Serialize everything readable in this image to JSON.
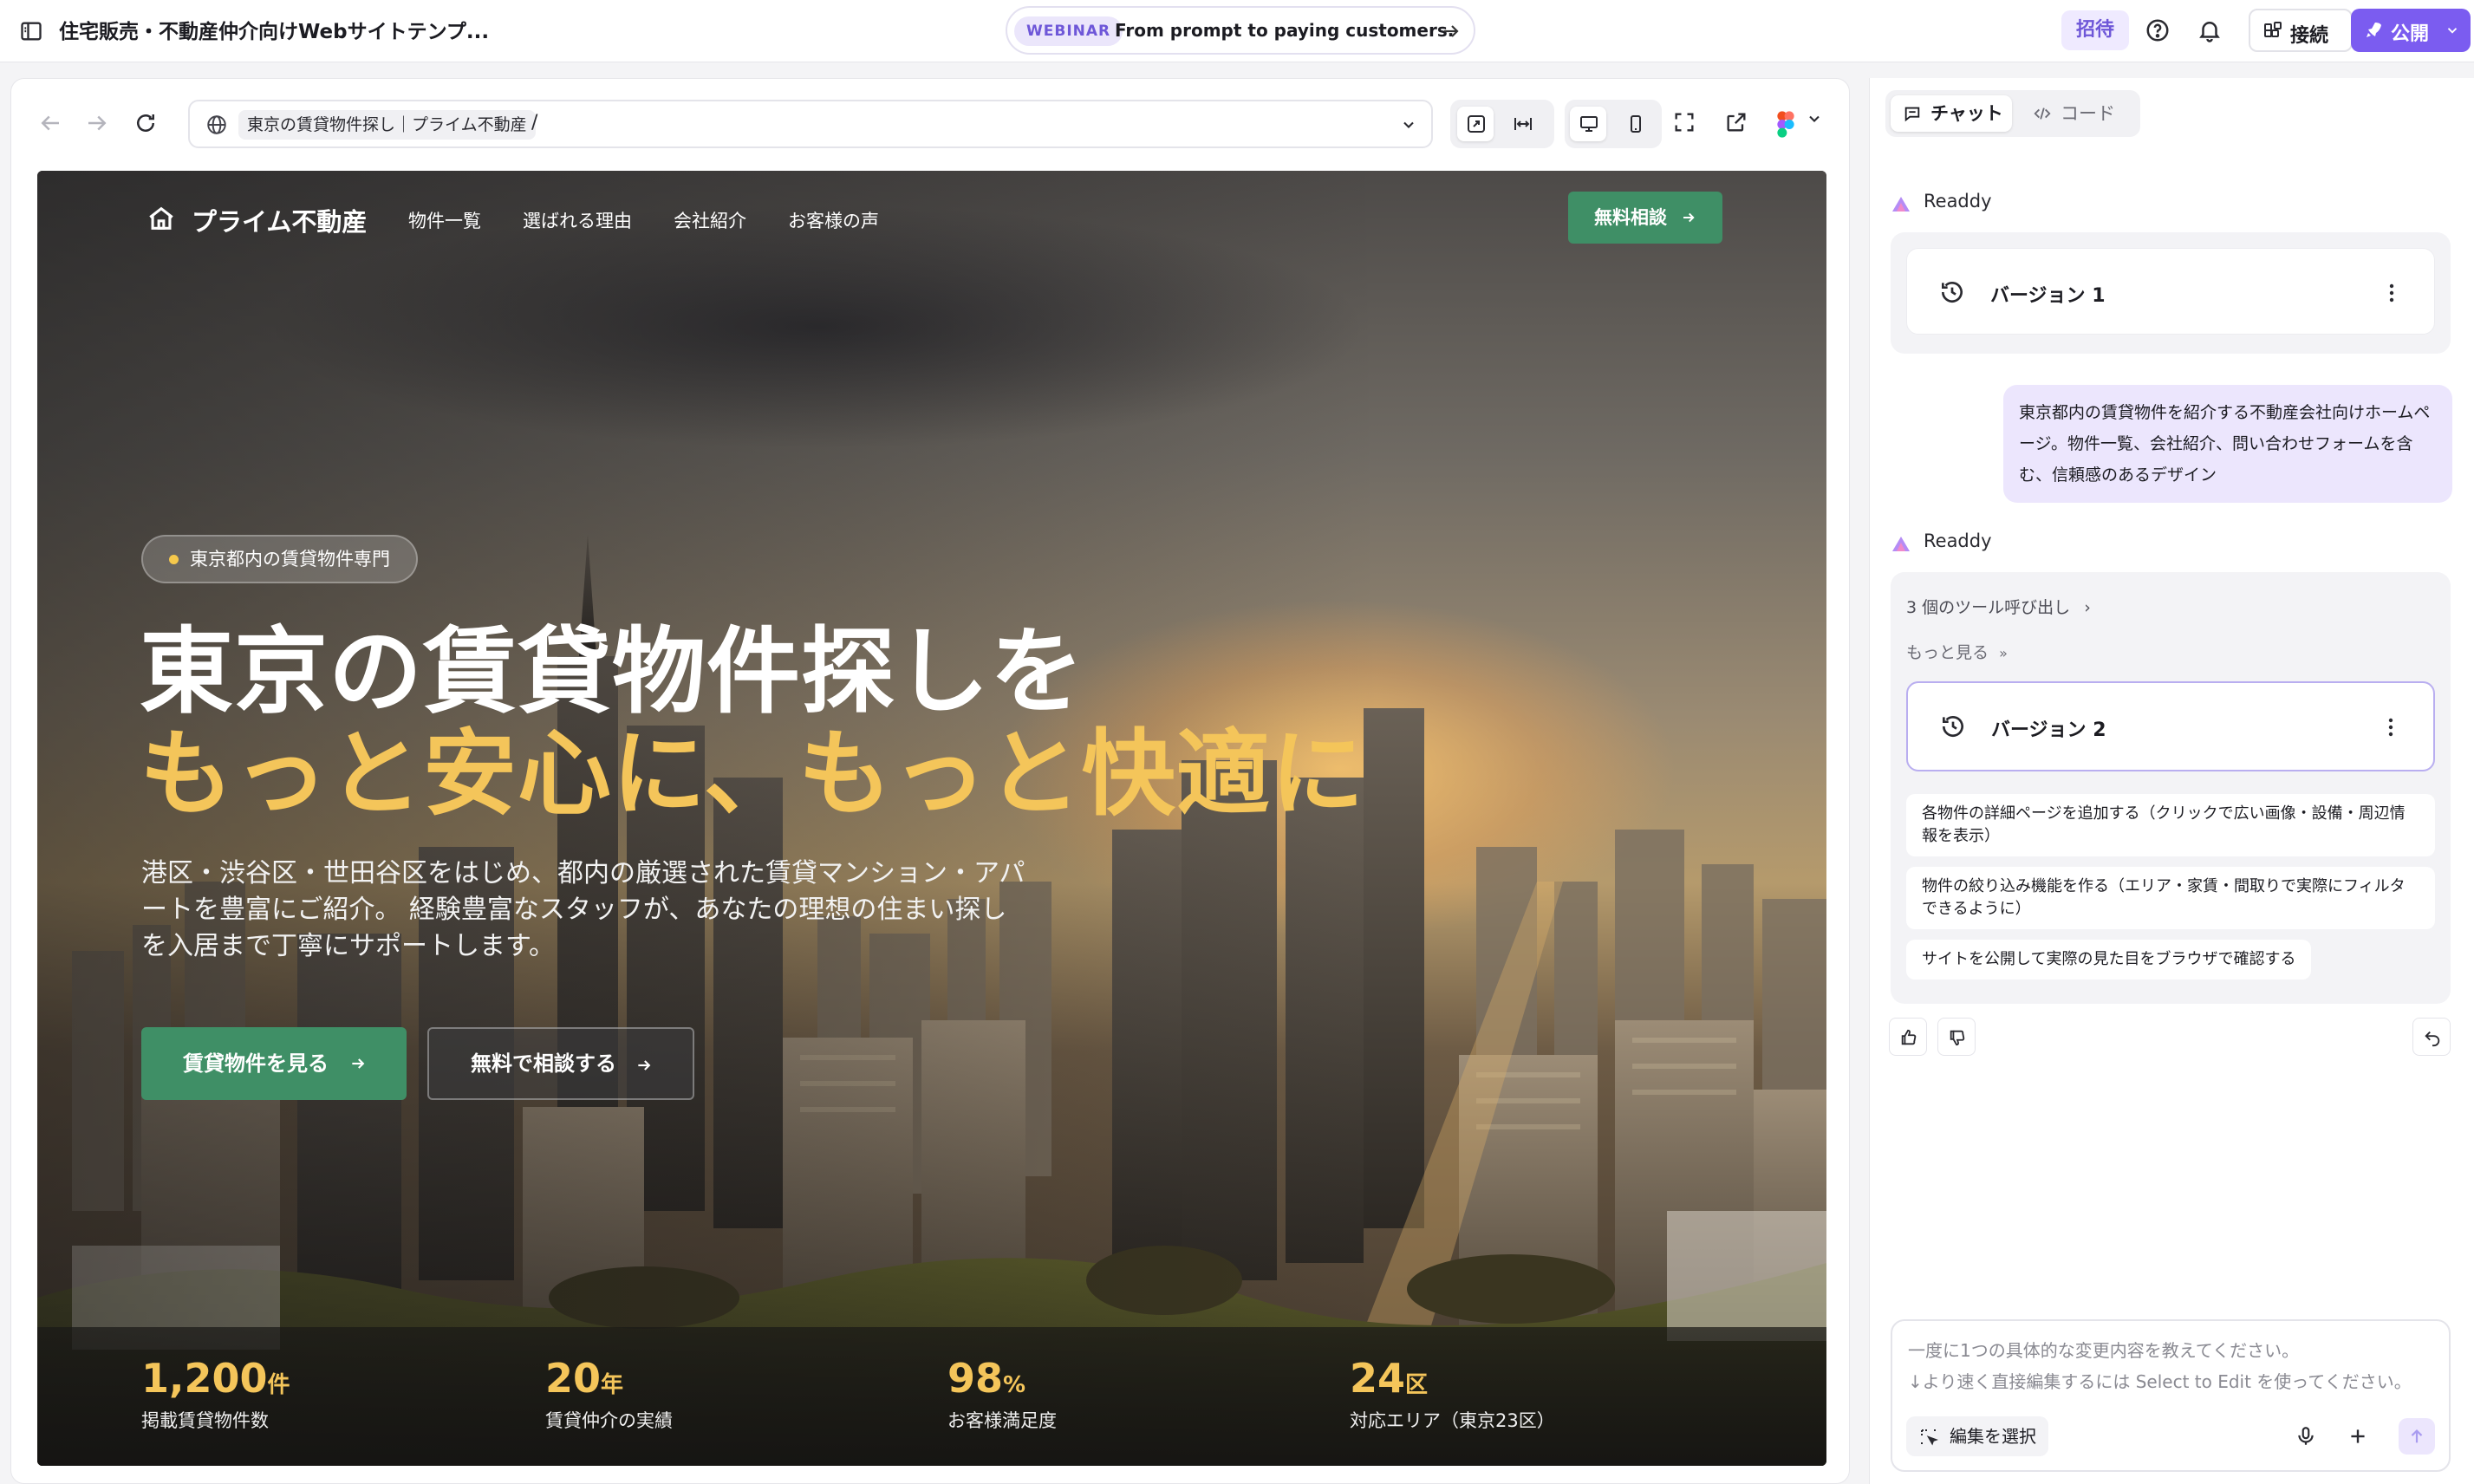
{
  "topbar": {
    "project_title": "住宅販売・不動産仲介向けWebサイトテンプ...",
    "webinar_badge": "WEBINAR",
    "webinar_text": "From prompt to paying customers.",
    "invite_label": "招待",
    "connect_label": "接続",
    "publish_label": "公開"
  },
  "browser": {
    "page_chip": "東京の賃貸物件探し｜プライム不動産",
    "path": "/"
  },
  "site": {
    "brand": "プライム不動産",
    "menu": [
      "物件一覧",
      "選ばれる理由",
      "会社紹介",
      "お客様の声"
    ],
    "nav_cta": "無料相談",
    "tag": "東京都内の賃貸物件専門",
    "headline_line1": "東京の賃貸物件探しを",
    "headline_line2": "もっと安心に、もっと快適に",
    "subtext": "港区・渋谷区・世田谷区をはじめ、都内の厳選された賃貸マンション・アパートを豊富にご紹介。 経験豊富なスタッフが、あなたの理想の住まい探しを入居まで丁寧にサポートします。",
    "primary_button": "賃貸物件を見る",
    "secondary_button": "無料で相談する",
    "stats": [
      {
        "value": "1,200",
        "unit": "件",
        "label": "掲載賃貸物件数"
      },
      {
        "value": "20",
        "unit": "年",
        "label": "賃貸仲介の実績"
      },
      {
        "value": "98",
        "unit": "%",
        "label": "お客様満足度"
      },
      {
        "value": "24",
        "unit": "区",
        "label": "対応エリア（東京23区）"
      }
    ]
  },
  "chat": {
    "tab_chat": "チャット",
    "tab_code": "コード",
    "agent_name": "Readdy",
    "version1": "バージョン 1",
    "user_message": "東京都内の賃貸物件を紹介する不動産会社向けホームページ。物件一覧、会社紹介、問い合わせフォームを含む、信頼感のあるデザイン",
    "tool_calls": "3 個のツール呼び出し",
    "show_more": "もっと見る",
    "version2": "バージョン 2",
    "suggestions": [
      "各物件の詳細ページを追加する（クリックで広い画像・設備・周辺情報を表示）",
      "物件の絞り込み機能を作る（エリア・家賃・間取りで実際にフィルタできるように）",
      "サイトを公開して実際の見た目をブラウザで確認する"
    ],
    "composer_placeholder_1": "一度に1つの具体的な変更内容を教えてください。",
    "composer_placeholder_2": "↓より速く直接編集するには Select to Edit を使ってください。",
    "select_edit": "編集を選択"
  },
  "colors": {
    "accent": "#7b5cf0",
    "site_green": "#3f8f66",
    "headline_yellow": "#f4c55a"
  }
}
